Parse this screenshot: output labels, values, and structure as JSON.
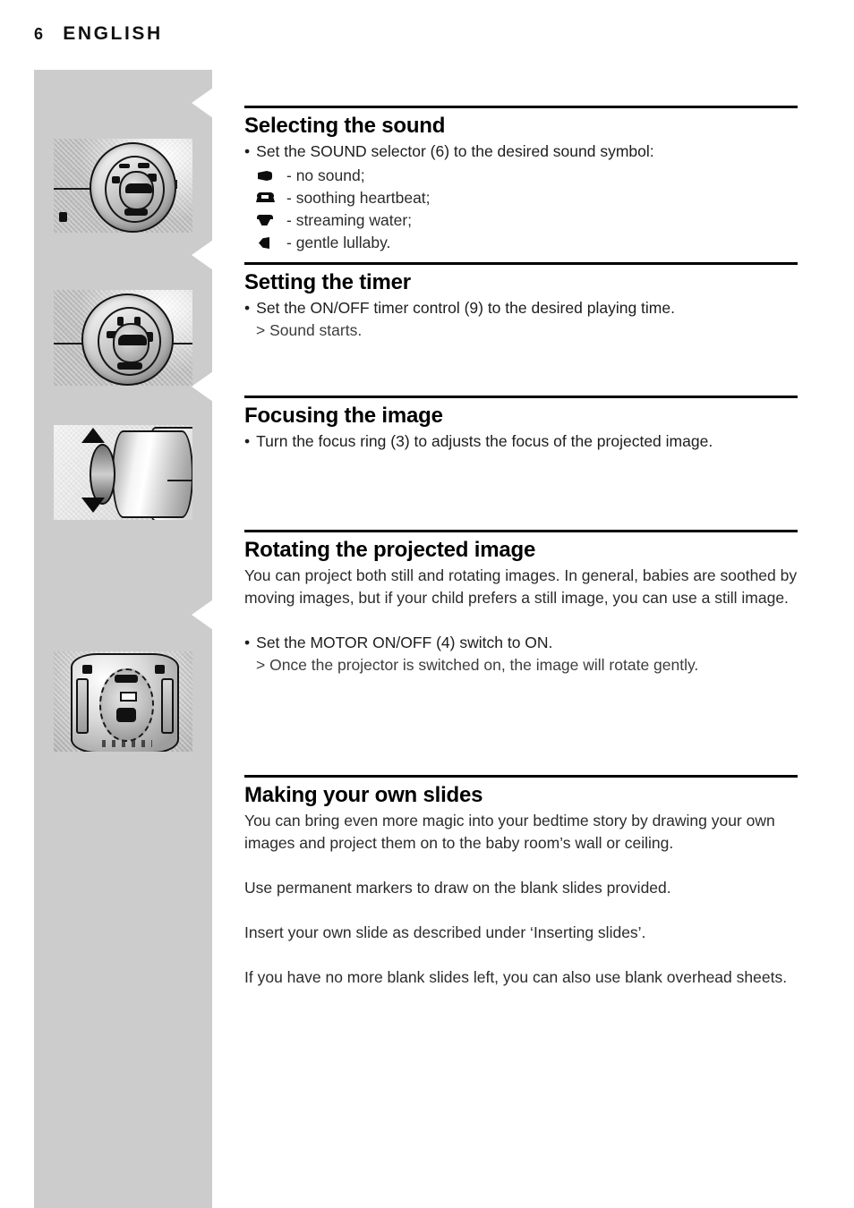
{
  "page": {
    "number": "6",
    "language": "ENGLISH"
  },
  "sections": [
    {
      "id": "selecting-the-sound",
      "heading": "Selecting the sound",
      "bullet": "Set the SOUND selector (6) to the desired sound symbol:",
      "symbols": [
        {
          "icon": "no-sound-icon",
          "label": "- no sound;"
        },
        {
          "icon": "soothing-heartbeat-icon",
          "label": "- soothing heartbeat;"
        },
        {
          "icon": "streaming-water-icon",
          "label": "- streaming water;"
        },
        {
          "icon": "gentle-lullaby-icon",
          "label": "- gentle lullaby."
        }
      ]
    },
    {
      "id": "setting-the-timer",
      "heading": "Setting the timer",
      "bullet": "Set the ON/OFF timer control (9) to the desired playing time.",
      "result": "> Sound starts."
    },
    {
      "id": "focusing-the-image",
      "heading": "Focusing the image",
      "bullet": "Turn the focus ring (3) to adjusts the focus of the projected image."
    },
    {
      "id": "rotating-the-projected-image",
      "heading": "Rotating the projected image",
      "intro": "You can project both still and rotating images. In general, babies are soothed by moving images, but if your child prefers a still image, you can use a still image.",
      "bullet": "Set the MOTOR ON/OFF (4) switch to ON.",
      "result": "> Once the projector is switched on, the image will rotate gently."
    },
    {
      "id": "making-your-own-slides",
      "heading": "Making your own slides",
      "paragraphs": [
        "You can bring even more magic into your bedtime story by drawing your own images and project them on to the baby room’s wall or ceiling.",
        "Use permanent markers to draw on the blank slides provided.",
        "Insert your own slide as described under ‘Inserting slides’.",
        "If you have no more blank slides left, you can also use blank overhead sheets."
      ]
    }
  ],
  "figures": [
    {
      "id": "figure-sound-selector",
      "name": "sound-selector-dial-photo"
    },
    {
      "id": "figure-timer-control",
      "name": "timer-control-dial-photo"
    },
    {
      "id": "figure-focus-ring",
      "name": "focus-ring-lens-photo"
    },
    {
      "id": "figure-motor-switch",
      "name": "motor-on-off-switch-photo"
    }
  ],
  "bullet_char": "•",
  "colors": {
    "sidebar_gray": "#cccccc",
    "rule_black": "#000000",
    "heading_black": "#000000",
    "body_gray": "#2b2b2b"
  }
}
